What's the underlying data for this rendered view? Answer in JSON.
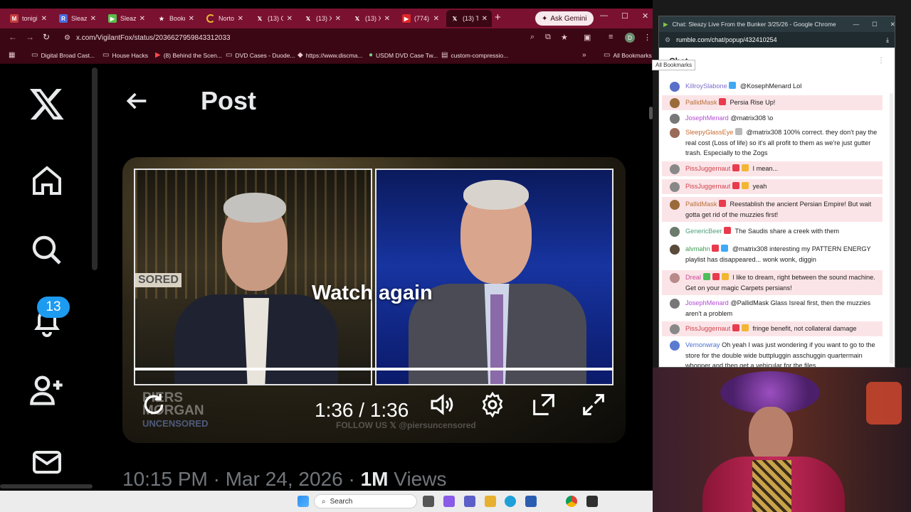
{
  "browser": {
    "tabs": [
      {
        "title": "tonigi",
        "color": "#c43d3d",
        "glyph": "M"
      },
      {
        "title": "Sleazy",
        "color": "#4a6bd8",
        "glyph": "R"
      },
      {
        "title": "Sleazy",
        "color": "#5bbd4b",
        "glyph": "▶"
      },
      {
        "title": "Bookm",
        "color": "#7a1130",
        "glyph": "★"
      },
      {
        "title": "Norto",
        "color": "#e8b830",
        "glyph": "◔"
      },
      {
        "title": "(13) C",
        "color": "#000000",
        "glyph": "X"
      },
      {
        "title": "(13) X",
        "color": "#000000",
        "glyph": "X"
      },
      {
        "title": "(13) X",
        "color": "#000000",
        "glyph": "X"
      },
      {
        "title": "(774)",
        "color": "#e02828",
        "glyph": "▶"
      },
      {
        "title": "(13) T",
        "color": "#000000",
        "glyph": "X"
      }
    ],
    "ask_gemini": "Ask Gemini",
    "url": "x.com/VigilantFox/status/2036627959843312033",
    "profile_initial": "D",
    "bookmarks": [
      "Digital Broad Cast...",
      "House Hacks",
      "(8) Behind the Scen...",
      "DVD Cases - Duode...",
      "https://www.discma...",
      "USDM DVD Case Tw...",
      "custom-compressio..."
    ],
    "all_bookmarks": "All Bookmarks",
    "tooltip": "All Bookmarks"
  },
  "x_page": {
    "header_title": "Post",
    "notification_count": "13",
    "video": {
      "overlay_text": "Watch again",
      "time": "1:36 / 1:36",
      "sored_text": "SORED",
      "logo_line1": "PIERS",
      "logo_line2": "MORGAN",
      "logo_line3": "UNCENSORED",
      "follow_text": "FOLLOW US  𝕏  @piersuncensored",
      "progress": 1.0
    },
    "meta_time": "10:15 PM · Mar 24, 2026 · ",
    "meta_views_count": "1M",
    "meta_views_label": " Views"
  },
  "taskbar": {
    "search_label": "Search"
  },
  "popup": {
    "title": "Chat: Sleazy Live From the Bunker 3/25/26 - Google Chrome",
    "url": "rumble.com/chat/popup/432410254",
    "chat_header": "Chat",
    "messages": [
      {
        "user": "KillroySlabone",
        "user_color": "#7b6fc9",
        "text": " @KosephMenard Lol",
        "highlight": false,
        "avatar_color": "#5870c8",
        "badges": [
          "#3fa9f5"
        ]
      },
      {
        "user": "PallidMask",
        "user_color": "#b8703a",
        "text": " Persia Rise Up!",
        "highlight": true,
        "avatar_color": "#9a6b3a",
        "badges": [
          "#e83b4e"
        ]
      },
      {
        "user": "JosephMenard",
        "user_color": "#b44ad4",
        "text": " @matrix308 \\o",
        "highlight": false,
        "avatar_color": "#777777",
        "badges": []
      },
      {
        "user": "SleepyGlassEye",
        "user_color": "#c86a2e",
        "text": " @matrix308 100% correct. they don't pay the real cost (Loss of life) so it's all profit to them as we're just gutter trash. Especially to the Zogs",
        "highlight": false,
        "avatar_color": "#9b6b5a",
        "badges": [
          "#b9b9b9"
        ]
      },
      {
        "user": "PissJuggernaut",
        "user_color": "#d0444e",
        "text": " I mean...",
        "highlight": true,
        "avatar_color": "#888888",
        "badges": [
          "#e83b4e",
          "#f2b632"
        ]
      },
      {
        "user": "PissJuggernaut",
        "user_color": "#d0444e",
        "text": " yeah",
        "highlight": true,
        "avatar_color": "#888888",
        "badges": [
          "#e83b4e",
          "#f2b632"
        ]
      },
      {
        "user": "PallidMask",
        "user_color": "#b8703a",
        "text": " Reestablish the ancient Persian Empire! But wait gotta get rid of the muzzies first!",
        "highlight": true,
        "avatar_color": "#9a6b3a",
        "badges": [
          "#e83b4e"
        ]
      },
      {
        "user": "GenericBeer",
        "user_color": "#4aa07a",
        "text": " The Saudis share a creek with them",
        "highlight": false,
        "avatar_color": "#6b7a6b",
        "badges": [
          "#e83b4e"
        ]
      },
      {
        "user": "alvmahn",
        "user_color": "#3f9b53",
        "text": " @matrix308 interesting my PATTERN ENERGY playlist has disappeared... wonk wonk, diggin",
        "highlight": false,
        "avatar_color": "#5a4a3a",
        "badges": [
          "#e83b4e",
          "#3fa9f5"
        ]
      },
      {
        "user": "Dreal",
        "user_color": "#c84a9a",
        "text": " I like to dream, right between the sound machine. Get on your magic Carpets persians!",
        "highlight": true,
        "avatar_color": "#b88a8a",
        "badges": [
          "#4cbf5a",
          "#e83b4e",
          "#f2b632"
        ]
      },
      {
        "user": "JosephMenard",
        "user_color": "#b44ad4",
        "text": " @PallidMask Glass Isreal first, then the muzzies aren't a problem",
        "highlight": false,
        "avatar_color": "#777777",
        "badges": []
      },
      {
        "user": "PissJuggernaut",
        "user_color": "#d0444e",
        "text": " fringe benefit, not collateral damage",
        "highlight": true,
        "avatar_color": "#888888",
        "badges": [
          "#e83b4e",
          "#f2b632"
        ]
      },
      {
        "user": "Vernonwray",
        "user_color": "#4a6fd0",
        "text": " Oh yeah I was just wondering if you want to go to the store for the double wide buttpluggin asschuggin quartermain whopper and then get a vehicular for the files",
        "highlight": false,
        "avatar_color": "#5a7bd0",
        "badges": []
      }
    ]
  }
}
